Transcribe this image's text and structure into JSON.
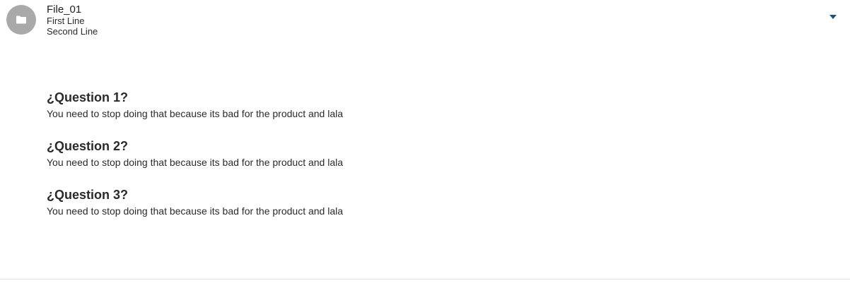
{
  "header": {
    "icon": "folder-icon",
    "title": "File_01",
    "line1": "First Line",
    "line2": "Second Line",
    "toggle_icon": "caret-down-icon"
  },
  "colors": {
    "avatar_bg": "#a9a9a9",
    "caret": "#1f4e79",
    "text": "#222222"
  },
  "faq": [
    {
      "question": "¿Question 1?",
      "answer": "You need to stop doing that because its bad for the product and lala"
    },
    {
      "question": "¿Question 2?",
      "answer": "You need to stop doing that because its bad for the product and lala"
    },
    {
      "question": "¿Question 3?",
      "answer": "You need to stop doing that because its bad for the product and lala"
    }
  ]
}
